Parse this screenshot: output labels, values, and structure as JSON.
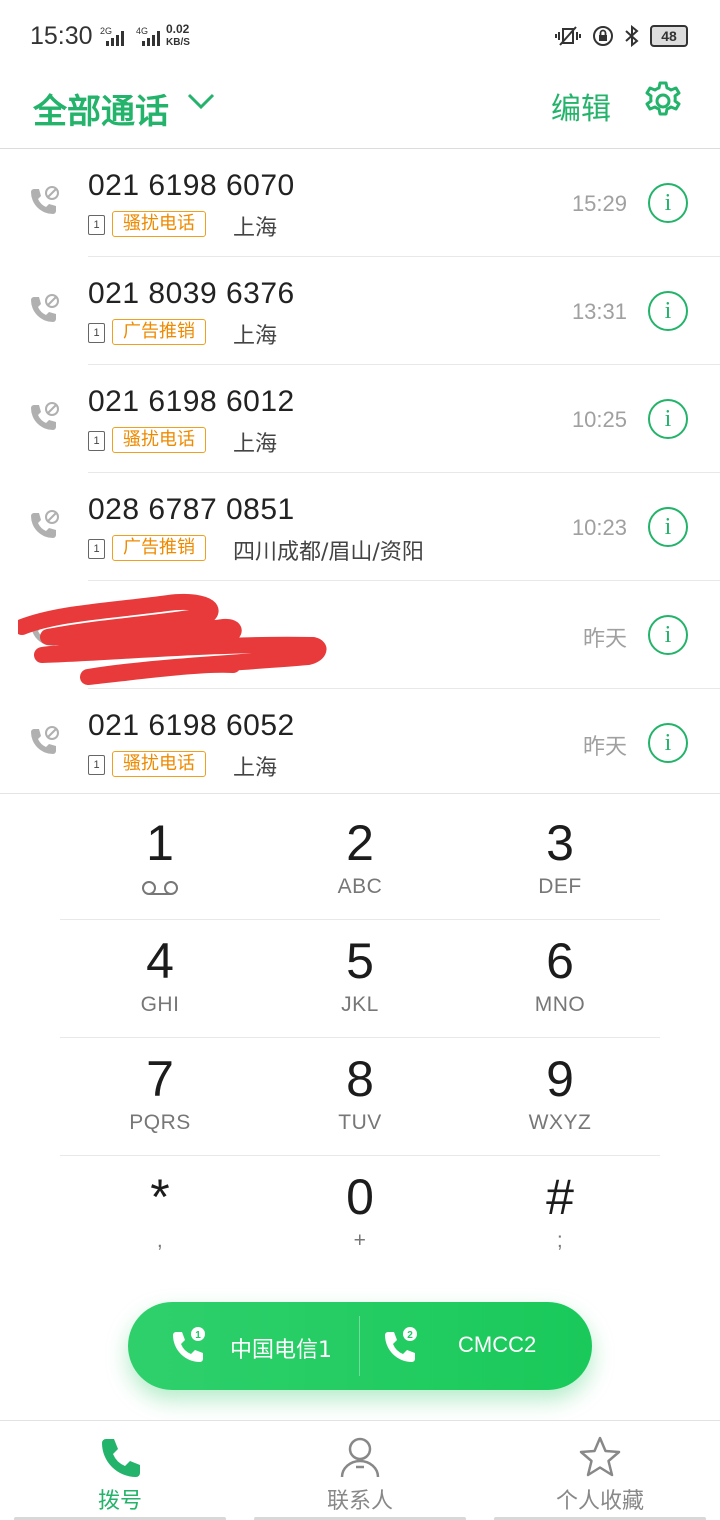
{
  "status_bar": {
    "time": "15:30",
    "signal1_label": "2G",
    "signal2_label": "4G",
    "speed_value": "0.02",
    "speed_unit": "KB/S",
    "battery": "48"
  },
  "header": {
    "title": "全部通话",
    "edit_label": "编辑"
  },
  "calls": [
    {
      "number": "021 6198 6070",
      "sim": "1",
      "tag": "骚扰电话",
      "location": "上海",
      "time": "15:29"
    },
    {
      "number": "021 8039 6376",
      "sim": "1",
      "tag": "广告推销",
      "location": "上海",
      "time": "13:31"
    },
    {
      "number": "021 6198 6012",
      "sim": "1",
      "tag": "骚扰电话",
      "location": "上海",
      "time": "10:25"
    },
    {
      "number": "028 6787 0851",
      "sim": "1",
      "tag": "广告推销",
      "location": "四川成都/眉山/资阳",
      "time": "10:23"
    },
    {
      "number": "",
      "sim": "",
      "tag": "",
      "location": "",
      "time": "昨天"
    },
    {
      "number": "021 6198 6052",
      "sim": "1",
      "tag": "骚扰电话",
      "location": "上海",
      "time": "昨天"
    }
  ],
  "keypad": {
    "keys": [
      {
        "digit": "1",
        "sub": ""
      },
      {
        "digit": "2",
        "sub": "ABC"
      },
      {
        "digit": "3",
        "sub": "DEF"
      },
      {
        "digit": "4",
        "sub": "GHI"
      },
      {
        "digit": "5",
        "sub": "JKL"
      },
      {
        "digit": "6",
        "sub": "MNO"
      },
      {
        "digit": "7",
        "sub": "PQRS"
      },
      {
        "digit": "8",
        "sub": "TUV"
      },
      {
        "digit": "9",
        "sub": "WXYZ"
      },
      {
        "digit": "*",
        "sub": ","
      },
      {
        "digit": "0",
        "sub": "+"
      },
      {
        "digit": "#",
        "sub": ";"
      }
    ]
  },
  "dial": {
    "sim1_label": "中国电信1",
    "sim1_index": "1",
    "sim2_label": "CMCC2",
    "sim2_index": "2"
  },
  "nav": {
    "items": [
      {
        "label": "拨号"
      },
      {
        "label": "联系人"
      },
      {
        "label": "个人收藏"
      }
    ]
  },
  "colors": {
    "accent": "#23b36a",
    "tag_border": "#f0a020",
    "tag_text": "#ee8a00",
    "redaction": "#e83a3a"
  }
}
